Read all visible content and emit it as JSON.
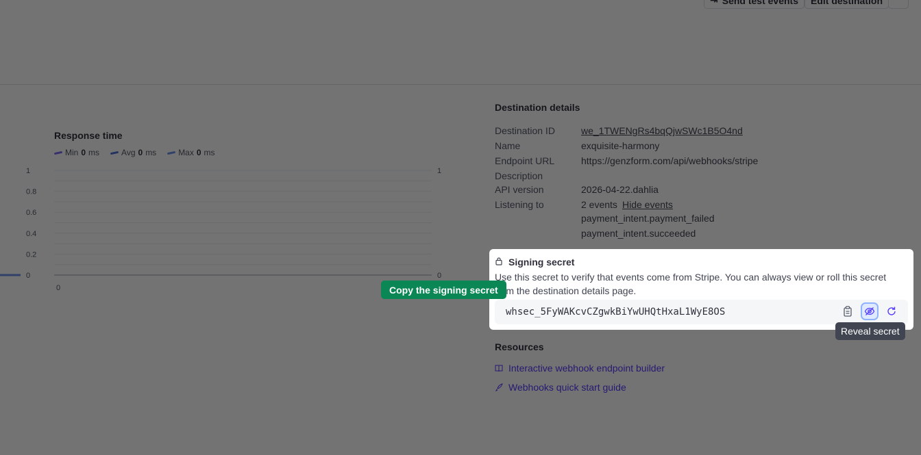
{
  "topbar": {
    "send_test_label": "Send test events",
    "edit_label": "Edit destination"
  },
  "chart": {
    "title": "Response time",
    "legend": [
      {
        "label": "Min",
        "value": "0",
        "unit": "ms",
        "color": "#7b6cf6"
      },
      {
        "label": "Avg",
        "value": "0",
        "unit": "ms",
        "color": "#4e6fd8"
      },
      {
        "label": "Max",
        "value": "0",
        "unit": "ms",
        "color": "#6b8fe6"
      }
    ],
    "left_axis_ticks": [
      "1",
      "0.8",
      "0.6",
      "0.4",
      "0.2",
      "0"
    ],
    "right_axis_ticks": [
      "1",
      "0"
    ],
    "x_tick": "0"
  },
  "chart_data": {
    "type": "line",
    "title": "Response time",
    "series": [
      {
        "name": "Min",
        "values": [
          0
        ]
      },
      {
        "name": "Avg",
        "values": [
          0
        ]
      },
      {
        "name": "Max",
        "values": [
          0
        ]
      }
    ],
    "ylim": [
      0,
      1
    ],
    "x": [
      "0"
    ]
  },
  "details": {
    "title": "Destination details",
    "rows": [
      {
        "label": "Destination ID",
        "value": "we_1TWENgRs4bqQjwSWc1B5O4nd"
      },
      {
        "label": "Name",
        "value": "exquisite-harmony"
      },
      {
        "label": "Endpoint URL",
        "value": "https://genzform.com/api/webhooks/stripe"
      },
      {
        "label": "Description",
        "value": ""
      },
      {
        "label": "API version",
        "value": "2026-04-22.dahlia"
      },
      {
        "label": "Listening to",
        "value": "2 events"
      }
    ],
    "hide_events_label": "Hide events",
    "events": [
      "payment_intent.payment_failed",
      "payment_intent.succeeded"
    ]
  },
  "signing": {
    "title": "Signing secret",
    "description_line1": "Use this secret to verify that events come from Stripe. You can always view or roll this secret",
    "description_line2": "from the destination details page.",
    "secret": "whsec_5FyWAKcvCZgwkBiYwUHQtHxaL1WyE8OS",
    "copy_icon": "clipboard-icon",
    "reveal_icon": "eye-off-icon",
    "roll_icon": "refresh-icon"
  },
  "tooltips": {
    "reveal": "Reveal secret",
    "copy": "Copy the signing secret"
  },
  "resources": {
    "title": "Resources",
    "links": [
      {
        "label": "Interactive webhook endpoint builder",
        "icon": "book-icon"
      },
      {
        "label": "Webhooks quick start guide",
        "icon": "rocket-icon"
      }
    ]
  }
}
